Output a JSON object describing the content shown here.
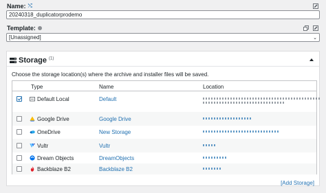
{
  "name_field": {
    "label": "Name:",
    "value": "20240318_duplicatorprodemo"
  },
  "template_field": {
    "label": "Template:",
    "value": "[Unassigned]"
  },
  "storage": {
    "title": "Storage",
    "count": "(1)",
    "description": "Choose the storage location(s) where the archive and installer files will be saved.",
    "columns": {
      "type": "Type",
      "name": "Name",
      "location": "Location"
    },
    "rows": [
      {
        "checked": true,
        "type": "Default Local",
        "icon": "folder-icon",
        "name": "Default"
      },
      {
        "checked": false,
        "type": "Google Drive",
        "icon": "google-drive-icon",
        "name": "Google Drive"
      },
      {
        "checked": false,
        "type": "OneDrive",
        "icon": "onedrive-icon",
        "name": "New Storage"
      },
      {
        "checked": false,
        "type": "Vultr",
        "icon": "vultr-icon",
        "name": "Vultr"
      },
      {
        "checked": false,
        "type": "Dream Objects",
        "icon": "dreamobjects-icon",
        "name": "DreamObjects"
      },
      {
        "checked": false,
        "type": "Backblaze B2",
        "icon": "backblaze-icon",
        "name": "Backblaze B2"
      }
    ],
    "add_link": "[Add Storage]"
  },
  "colors": {
    "link": "#2271b1",
    "border": "#8c8f94",
    "background": "#f0f0f1"
  }
}
